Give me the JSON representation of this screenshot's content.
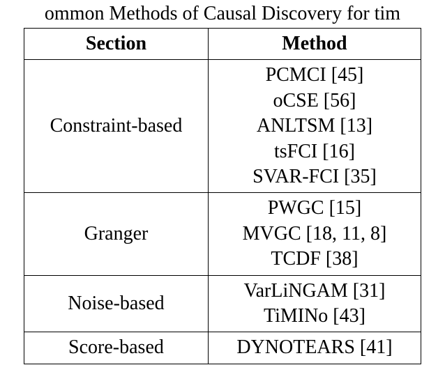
{
  "caption": "ommon Methods of Causal Discovery for tim",
  "headers": {
    "section": "Section",
    "method": "Method"
  },
  "rows": [
    {
      "section": "Constraint-based",
      "methods": [
        "PCMCI [45]",
        "oCSE [56]",
        "ANLTSM [13]",
        "tsFCI [16]",
        "SVAR-FCI [35]"
      ]
    },
    {
      "section": "Granger",
      "methods": [
        "PWGC [15]",
        "MVGC [18, 11, 8]",
        "TCDF [38]"
      ]
    },
    {
      "section": "Noise-based",
      "methods": [
        "VarLiNGAM [31]",
        "TiMINo [43]"
      ]
    },
    {
      "section": "Score-based",
      "methods": [
        "DYNOTEARS [41]"
      ]
    }
  ]
}
